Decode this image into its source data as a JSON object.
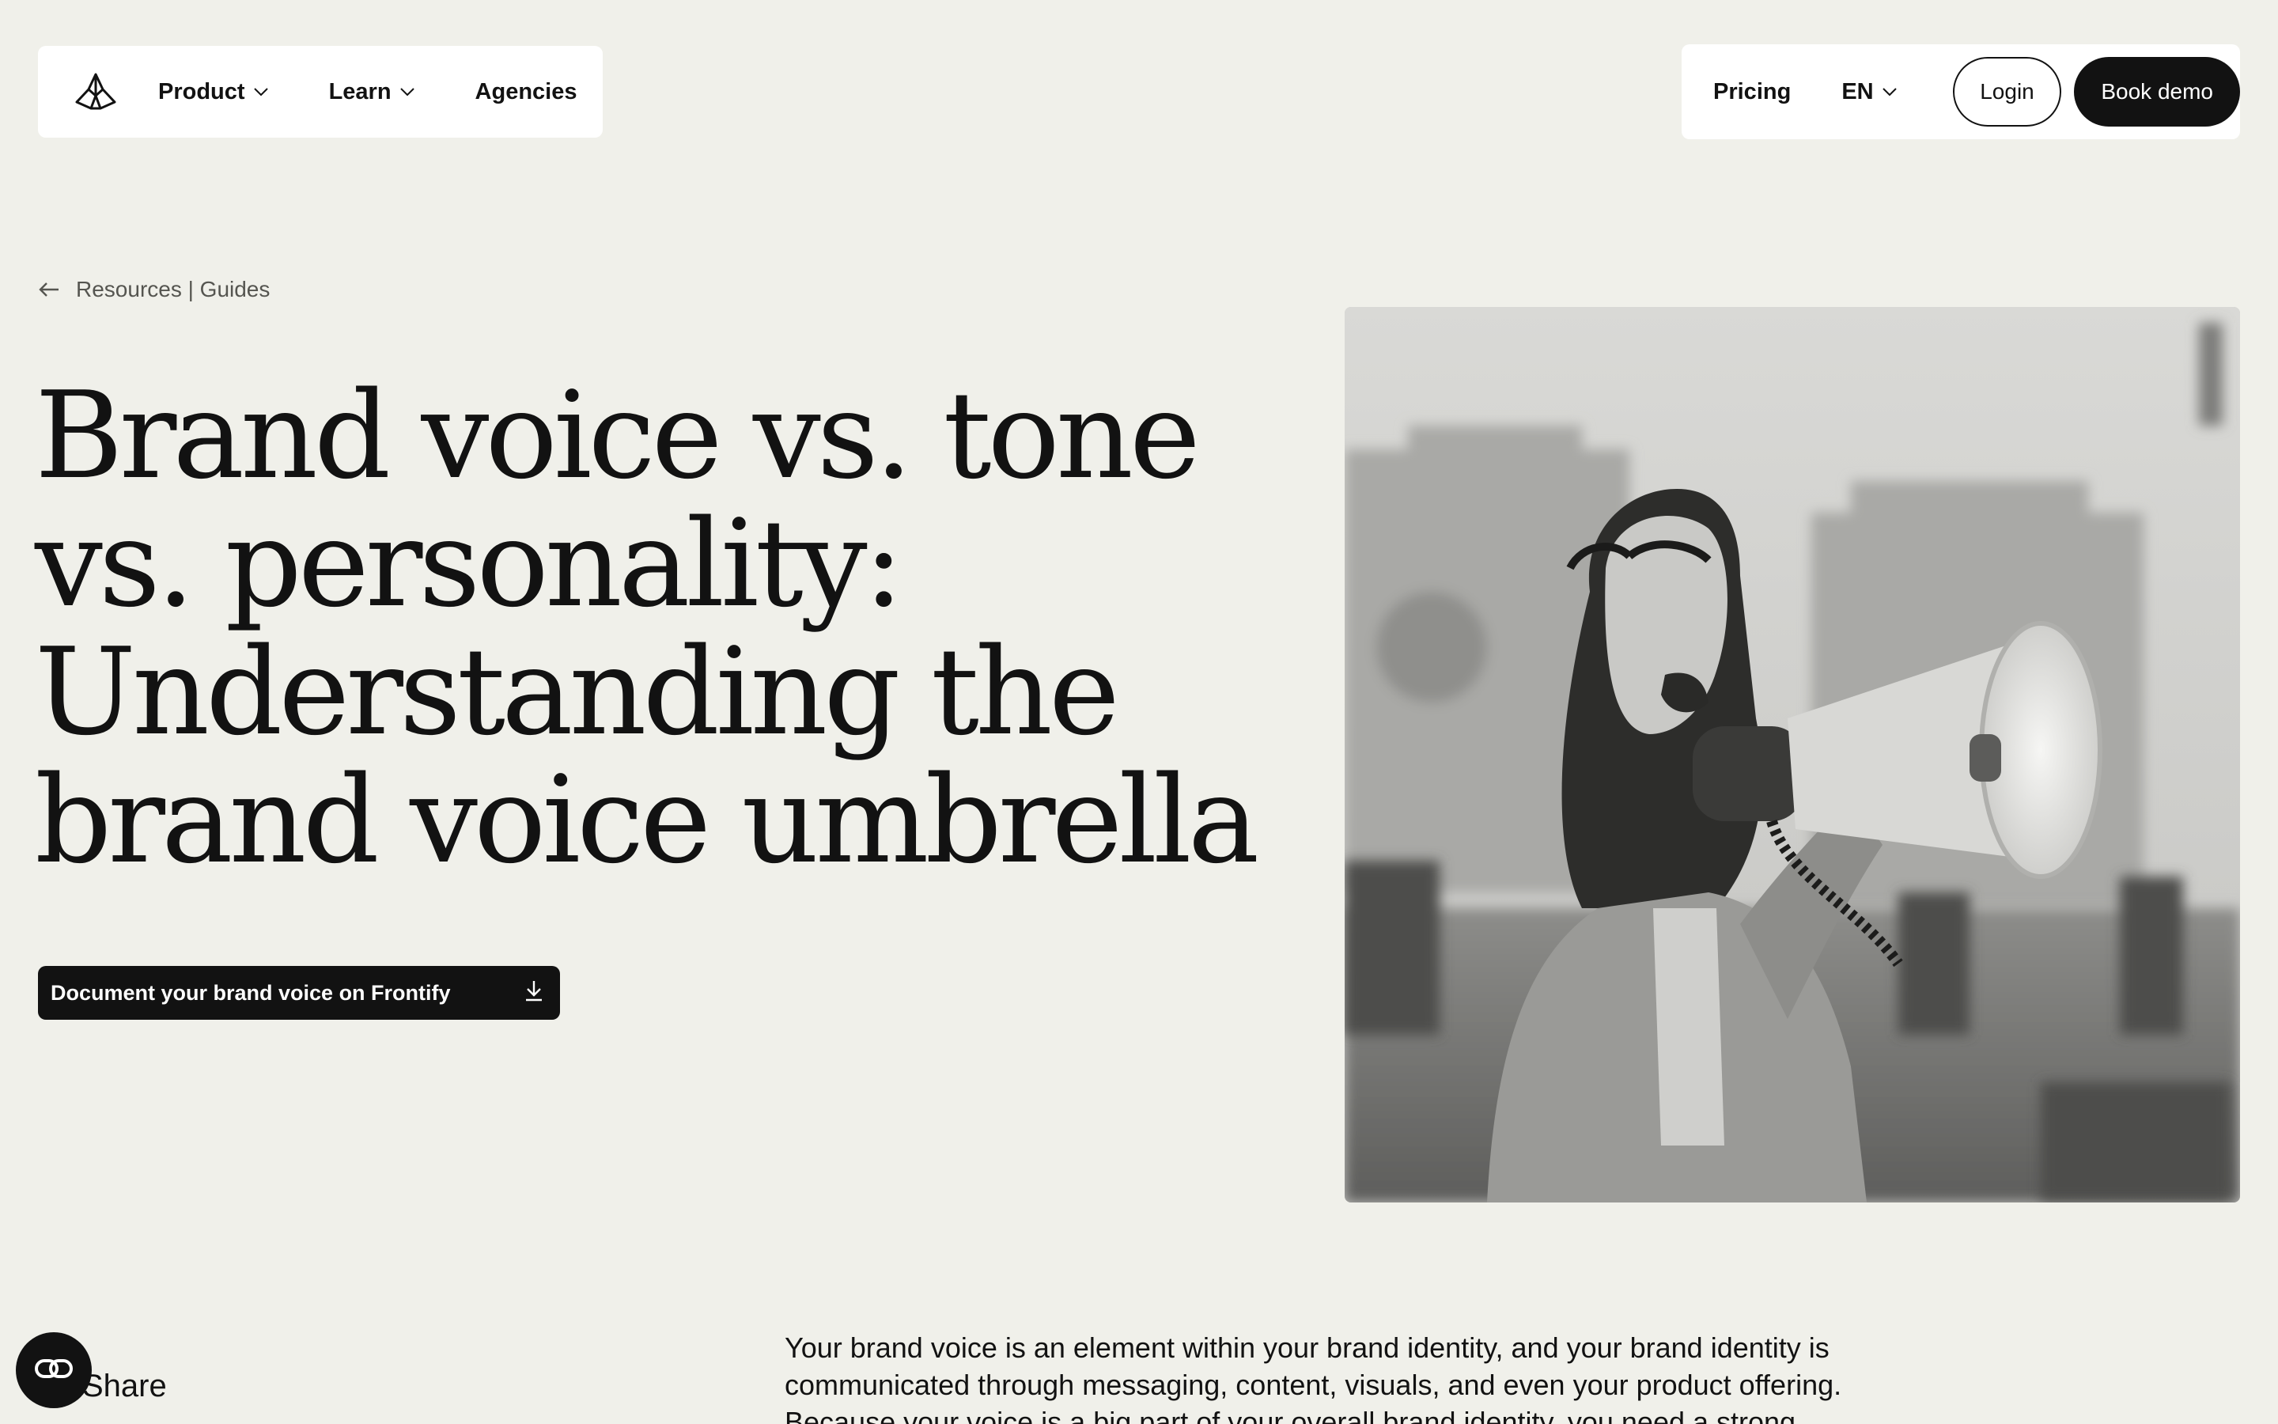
{
  "nav": {
    "logo_icon": "frontify-logo-icon",
    "product_label": "Product",
    "learn_label": "Learn",
    "agencies_label": "Agencies",
    "pricing_label": "Pricing",
    "language_label": "EN",
    "login_label": "Login",
    "book_demo_label": "Book demo"
  },
  "breadcrumb": {
    "icon": "arrow-left-icon",
    "label": "Resources | Guides"
  },
  "hero": {
    "title": "Brand voice vs. tone vs. personality: Understanding the brand voice umbrella",
    "cta_label": "Document your brand voice on Frontify",
    "cta_icon": "download-icon",
    "image": "black-and-white photo of a smiling woman shouting into a megaphone"
  },
  "share": {
    "label": "Share",
    "icon": "share-link-icon"
  },
  "intro": {
    "text": "Your brand voice is an element within your brand identity, and your brand identity is communicated through messaging, content, visuals, and even your product offering. Because your voice is a big part of your overall brand identity, you need a strong"
  },
  "colors": {
    "background": "#f0f0ea",
    "surface": "#ffffff",
    "ink": "#121212",
    "muted": "#555550"
  }
}
